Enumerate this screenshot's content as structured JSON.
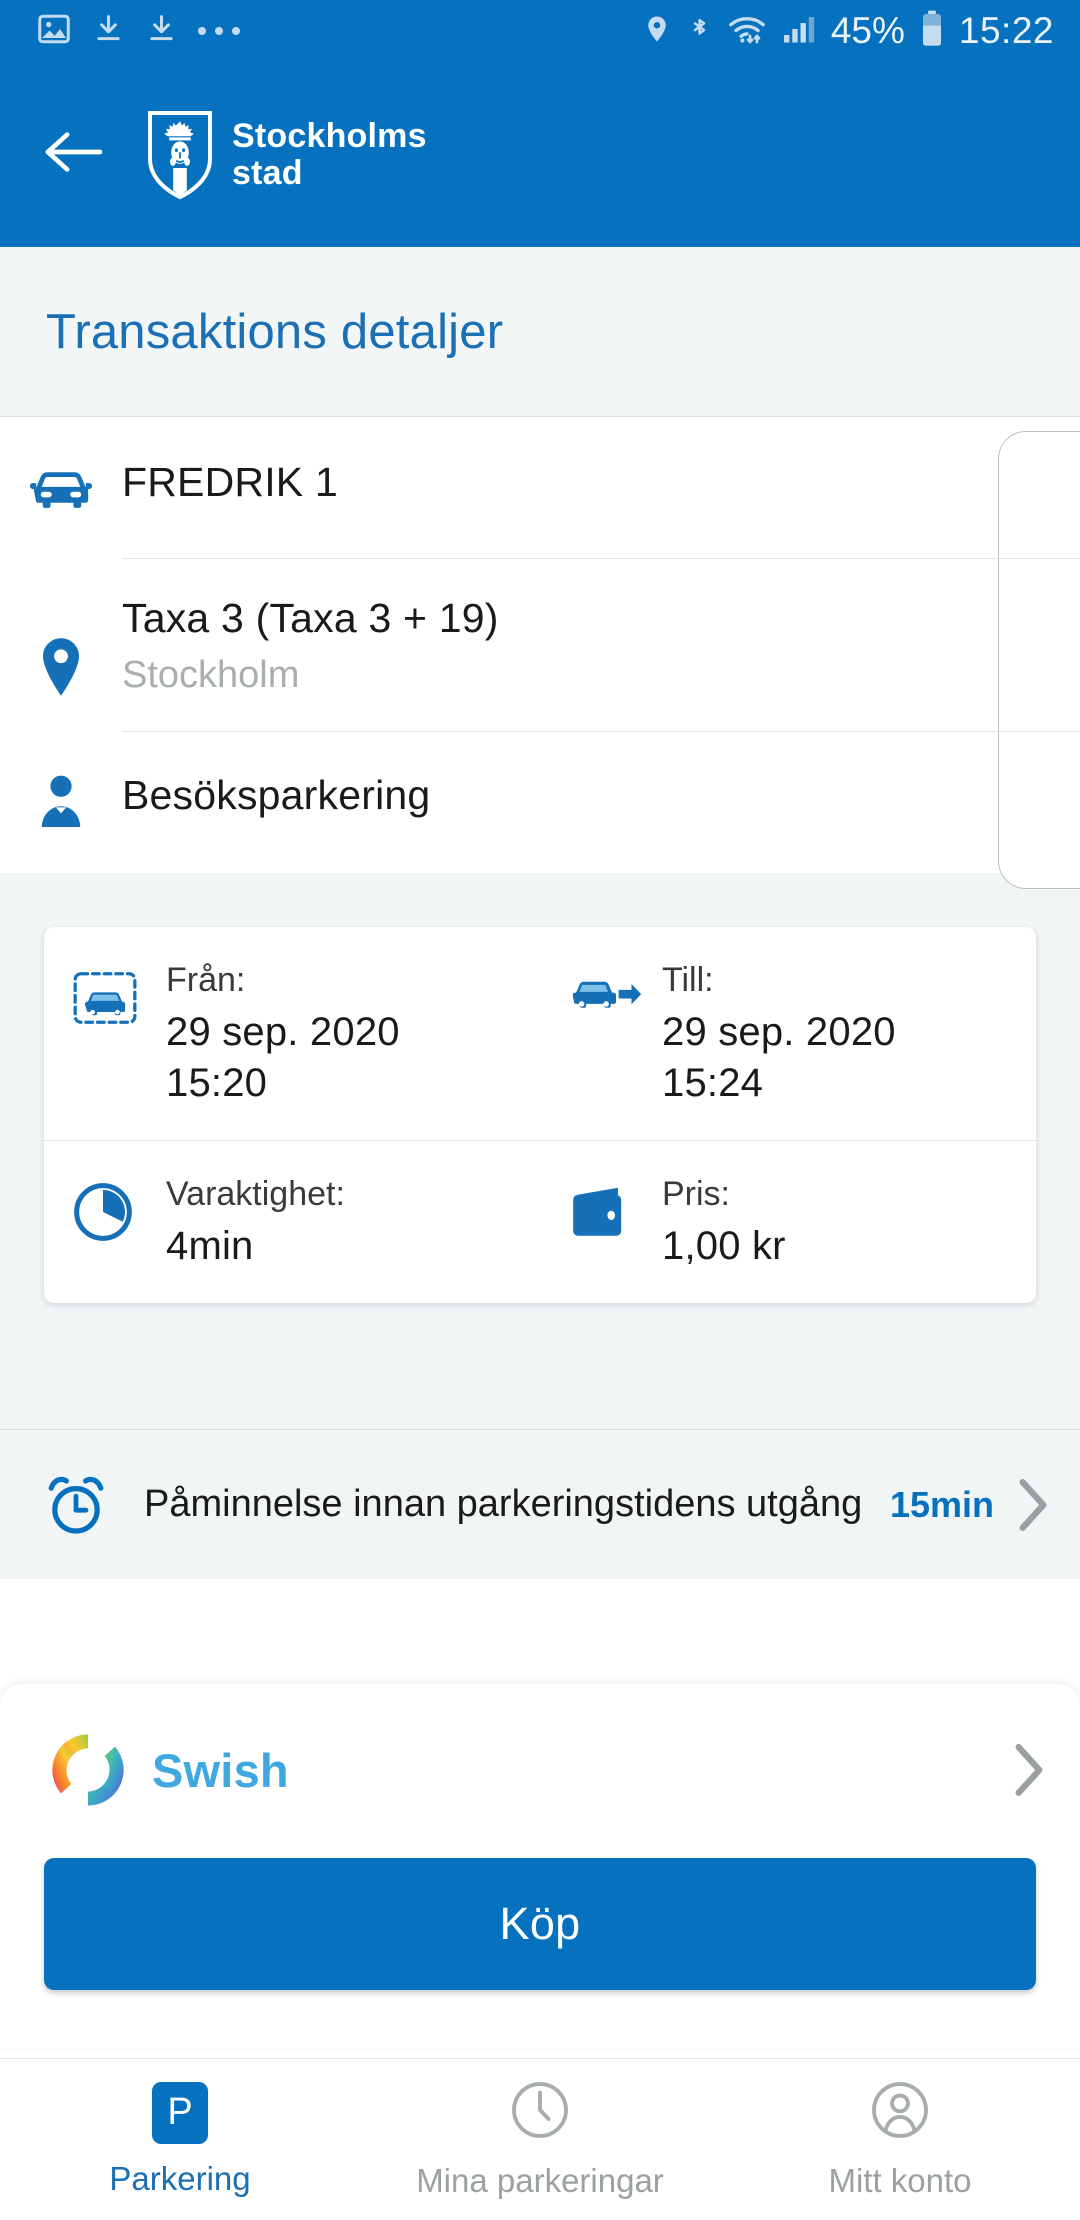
{
  "statusbar": {
    "icons_left": [
      "image-icon",
      "download-icon",
      "download-icon",
      "more-dots-icon"
    ],
    "icons_right": [
      "location-icon",
      "bluetooth-icon",
      "wifi-icon",
      "signal-icon"
    ],
    "battery_percent": "45%",
    "time": "15:22"
  },
  "header": {
    "back_icon": "back-arrow-icon",
    "brand_line1": "Stockholms",
    "brand_line2": "stad",
    "logo_icon": "stockholm-shield-icon",
    "background_color": "#0571BF"
  },
  "page": {
    "title": "Transaktions detaljer"
  },
  "details": [
    {
      "icon": "car-icon",
      "title": "FREDRIK 1",
      "subtitle": ""
    },
    {
      "icon": "map-pin-icon",
      "title": "Taxa 3 (Taxa 3 + 19)",
      "subtitle": "Stockholm"
    },
    {
      "icon": "person-icon",
      "title": "Besöksparkering",
      "subtitle": ""
    }
  ],
  "time_card": {
    "from": {
      "icon": "car-parked-icon",
      "label": "Från:",
      "date": "29 sep. 2020",
      "time": "15:20"
    },
    "to": {
      "icon": "car-leaving-icon",
      "label": "Till:",
      "date": "29 sep. 2020",
      "time": "15:24"
    },
    "duration": {
      "icon": "pie-clock-icon",
      "label": "Varaktighet:",
      "value": "4min"
    },
    "price": {
      "icon": "wallet-icon",
      "label": "Pris:",
      "value": "1,00 kr"
    }
  },
  "reminder": {
    "icon": "alarm-clock-icon",
    "label": "Påminnelse innan parkeringstidens utgång",
    "value": "15min",
    "chevron": "chevron-right-icon"
  },
  "payment": {
    "logo": "swish-logo-icon",
    "name": "Swish",
    "chevron": "chevron-right-icon"
  },
  "buy_button": {
    "label": "Köp"
  },
  "bottom_nav": [
    {
      "icon": "parking-p-icon",
      "label": "Parkering",
      "active": true
    },
    {
      "icon": "clock-icon",
      "label": "Mina parkeringar",
      "active": false
    },
    {
      "icon": "account-icon",
      "label": "Mitt konto",
      "active": false
    }
  ],
  "colors": {
    "brand_blue": "#0571BF",
    "title_blue": "#1B6FB5",
    "page_bg": "#F1F5F6",
    "swish_blue": "#3FA8E0"
  }
}
